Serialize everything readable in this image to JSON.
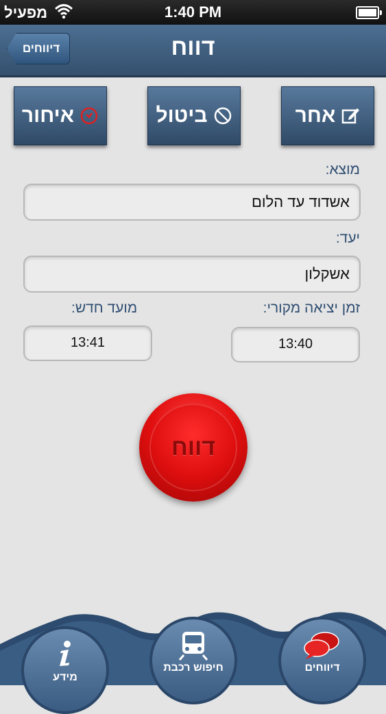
{
  "status_bar": {
    "carrier": "מפעיל",
    "time": "1:40 PM"
  },
  "nav": {
    "title": "דווח",
    "back_label": "דיווחים"
  },
  "actions": [
    {
      "label": "איחור",
      "icon": "clock-icon"
    },
    {
      "label": "ביטול",
      "icon": "cancel-icon"
    },
    {
      "label": "אחר",
      "icon": "edit-icon"
    }
  ],
  "form": {
    "origin_label": "מוצא:",
    "origin_value": "אשדוד עד הלום",
    "dest_label": "יעד:",
    "dest_value": "אשקלון",
    "orig_time_label": "זמן יציאה מקורי:",
    "orig_time_value": "13:40",
    "new_time_label": "מועד חדש:",
    "new_time_value": "13:41"
  },
  "report_button": {
    "label": "דווח",
    "color": "#e10f0f"
  },
  "tabs": [
    {
      "label": "מידע",
      "icon": "info-icon"
    },
    {
      "label": "חיפוש רכבת",
      "icon": "train-icon"
    },
    {
      "label": "דיווחים",
      "icon": "chat-bubbles-icon"
    }
  ],
  "colors": {
    "nav": "#3e5f82",
    "label_text": "#2f4e72",
    "background": "#e4e4e4"
  }
}
